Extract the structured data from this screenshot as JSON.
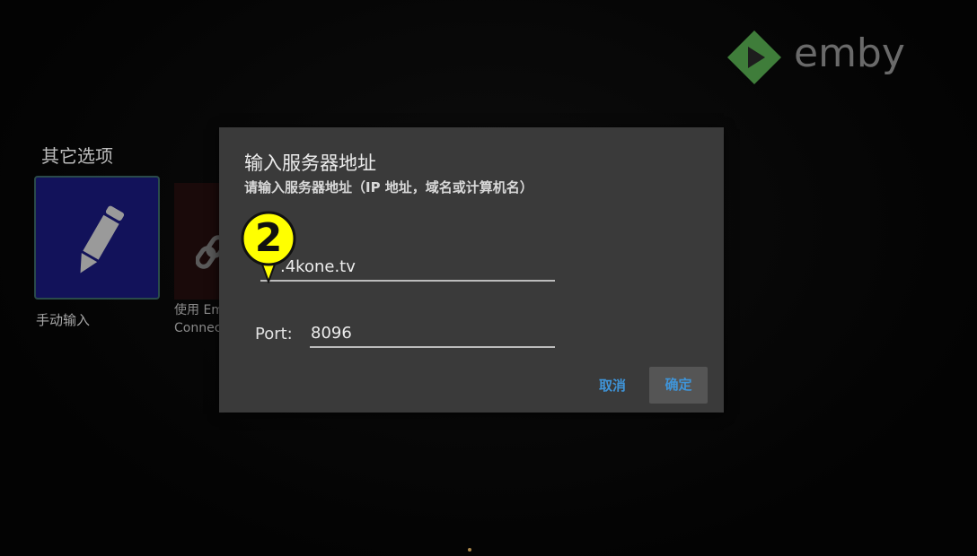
{
  "brand": {
    "name": "emby",
    "colors": {
      "logo_green": "#3f7d3a",
      "logo_text": "#6a6a6a"
    }
  },
  "background": {
    "section_title": "其它选项",
    "tiles": [
      {
        "label": "手动输入",
        "icon": "pencil-icon"
      },
      {
        "label": "使用 Em\nConnect",
        "icon": "link-icon"
      }
    ]
  },
  "dialog": {
    "title": "输入服务器地址",
    "subtitle": "请输入服务器地址（IP 地址，域名或计算机名）",
    "host_value": ".4kone.tv",
    "port_label": "Port:",
    "port_value": "8096",
    "cancel_label": "取消",
    "ok_label": "确定",
    "accent_color": "#3f94d8"
  },
  "annotation": {
    "number": "2",
    "color": "#ffff00"
  }
}
